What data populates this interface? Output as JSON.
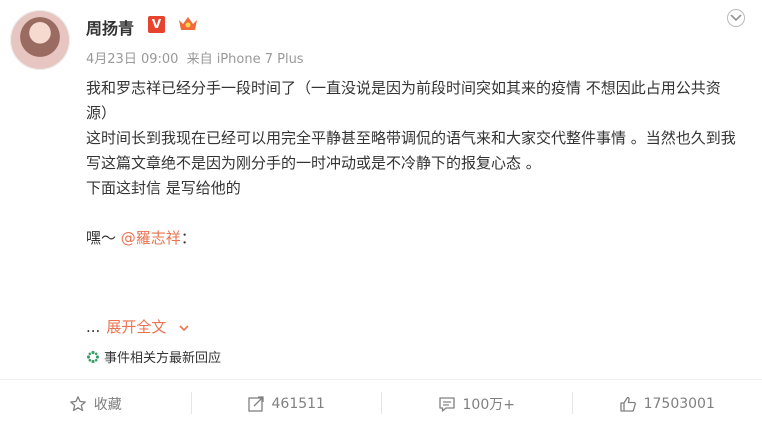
{
  "user": {
    "name": "周扬青",
    "verified_badge": "V"
  },
  "meta": {
    "date": "4月23日 09:00",
    "source": "来自 iPhone 7 Plus"
  },
  "post": {
    "p1": "我和罗志祥已经分手一段时间了（一直没说是因为前段时间突如其来的疫情 不想因此占用公共资源）",
    "p2": "这时间长到我现在已经可以用完全平静甚至略带调侃的语气来和大家交代整件事情 。当然也久到我写这篇文章绝不是因为刚分手的一时冲动或是不冷静下的报复心态 。",
    "p3": "下面这封信 是写给他的",
    "greeting": "嘿～",
    "mention": "@羅志祥",
    "mention_suffix": "："
  },
  "expand": {
    "ellipsis": "...",
    "label": "展开全文"
  },
  "event_link": {
    "label": "事件相关方最新回应"
  },
  "actions": {
    "favorite": "收藏",
    "repost": "461511",
    "comment": "100万+",
    "like": "17503001"
  },
  "colors": {
    "accent": "#eb7350",
    "verified": "#e8432d",
    "event_icon": "#3f9f6b"
  },
  "icons": [
    "more-icon",
    "crown-badge-icon",
    "star-icon",
    "repost-icon",
    "comment-icon",
    "like-icon",
    "chevron-down-icon",
    "event-icon"
  ]
}
